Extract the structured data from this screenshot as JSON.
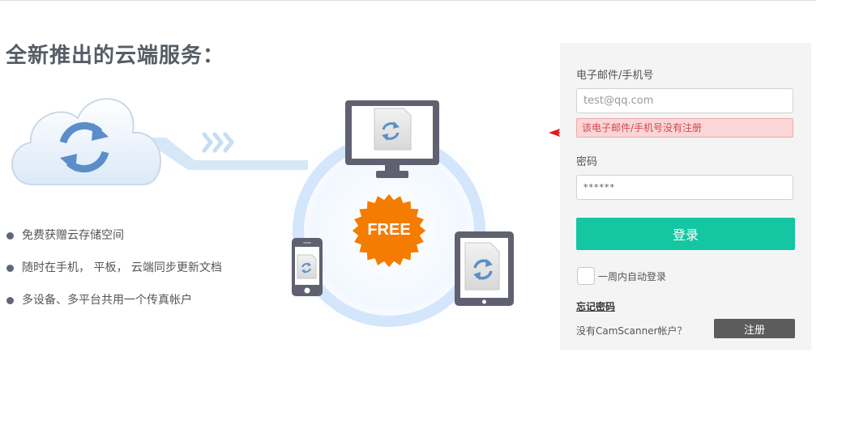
{
  "headline": "全新推出的云端服务：",
  "badge": {
    "label": "FREE",
    "color": "#f47c00"
  },
  "features": [
    {
      "text": "免费获赠云存储空间"
    },
    {
      "text": "随时在手机， 平板， 云端同步更新文档"
    },
    {
      "text": "多设备、多平台共用一个传真帐户"
    }
  ],
  "icons": {
    "cloud": "cloud-sync-icon",
    "monitor": "monitor-icon",
    "phone": "phone-icon",
    "tablet": "tablet-icon",
    "sync": "sync-icon"
  },
  "login_form": {
    "email_label": "电子邮件/手机号",
    "email_placeholder": "test@qq.com",
    "email_error": "该电子邮件/手机号没有注册",
    "password_label": "密码",
    "password_value": "******",
    "login_button": "登录",
    "remember_label": "一周内自动登录",
    "remember_checked": false,
    "forgot_link": "忘记密码",
    "no_account_text": "没有CamScanner帐户？",
    "register_button": "注册"
  },
  "colors": {
    "accent": "#14c6a2",
    "error_bg": "#fbd6d7",
    "error_text": "#d0474f",
    "register_bg": "#5c5c5c",
    "panel_bg": "#f4f4f4",
    "sync_blue": "#5b8ec9",
    "arrow": "#e8181e"
  }
}
